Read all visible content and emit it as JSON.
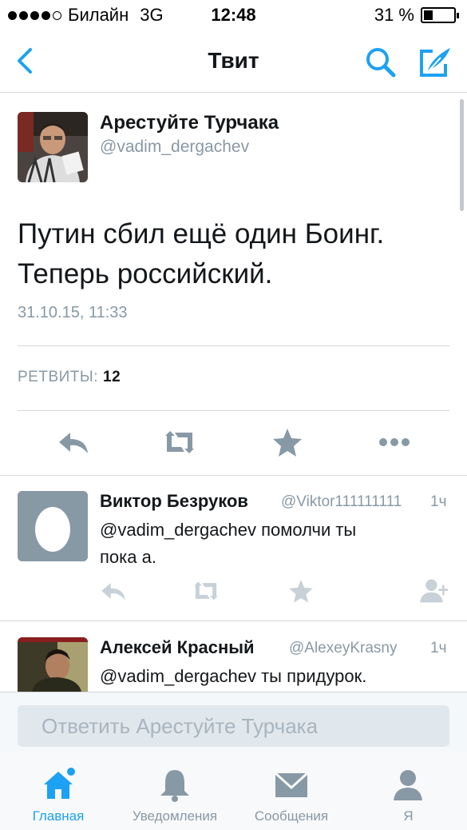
{
  "status_bar": {
    "carrier": "Билайн",
    "network": "3G",
    "time": "12:48",
    "battery": "31 %",
    "battery_level": 0.31
  },
  "nav": {
    "title": "Твит"
  },
  "tweet": {
    "author_name": "Арестуйте Турчака",
    "author_handle": "@vadim_dergachev",
    "text_line1": "Путин сбил ещё один Боинг.",
    "text_line2": "Теперь российский.",
    "date": "31.10.15, 11:33",
    "retweets_label": "РЕТВИТЫ:",
    "retweets_count": "12"
  },
  "replies": [
    {
      "name": "Виктор Безруков",
      "handle": "@Viktor111111111",
      "time": "1ч",
      "text_line1": "@vadim_dergachev помолчи ты",
      "text_line2": "пока а."
    },
    {
      "name": "Алексей Красный",
      "handle": "@AlexeyKrasny",
      "time": "1ч",
      "text_line1": "@vadim_dergachev ты придурок."
    }
  ],
  "reply_bar": {
    "placeholder": "Ответить Арестуйте Турчака"
  },
  "tabs": [
    {
      "label": "Главная",
      "icon": "home-icon",
      "active": true
    },
    {
      "label": "Уведомления",
      "icon": "bell-icon",
      "active": false
    },
    {
      "label": "Сообщения",
      "icon": "envelope-icon",
      "active": false
    },
    {
      "label": "Я",
      "icon": "person-icon",
      "active": false
    }
  ],
  "colors": {
    "accent": "#1da1f2",
    "icon_gray": "#8899a6",
    "icon_light": "#c8d1d8",
    "text": "#14171a",
    "muted": "#8899a6"
  }
}
